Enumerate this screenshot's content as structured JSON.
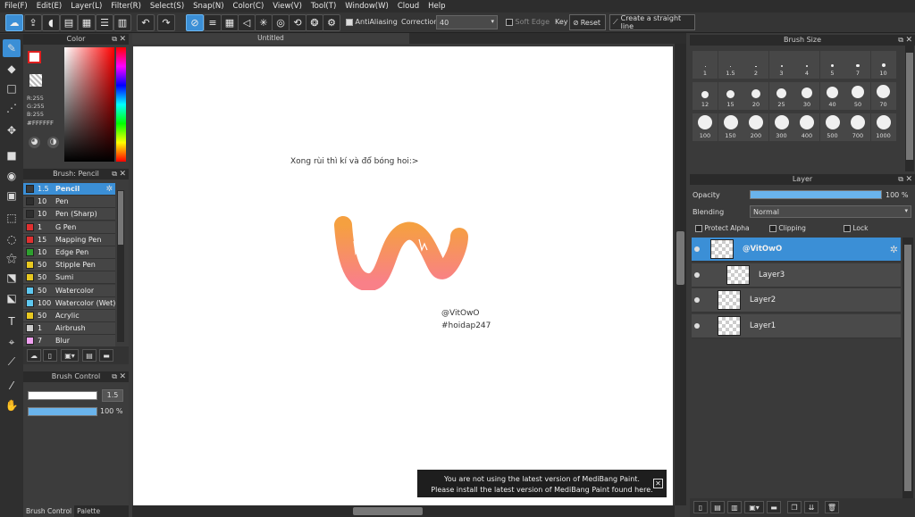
{
  "menu": [
    "File(F)",
    "Edit(E)",
    "Layer(L)",
    "Filter(R)",
    "Select(S)",
    "Snap(N)",
    "Color(C)",
    "View(V)",
    "Tool(T)",
    "Window(W)",
    "Cloud",
    "Help"
  ],
  "toolbar": {
    "antialiasing_label": "AntiAliasing",
    "correction_label": "Correction",
    "correction_value": "40",
    "soft_edge_label": "Soft Edge",
    "key_label": "Key",
    "reset_label": "Reset",
    "straight_line_label": "Create a straight line"
  },
  "color_panel": {
    "title": "Color",
    "r": "R:255",
    "g": "G:255",
    "b": "B:255",
    "hex": "#FFFFFF"
  },
  "brush_panel": {
    "title": "Brush: Pencil",
    "items": [
      {
        "size": "1.5",
        "name": "Pencil",
        "color": "#3b3b3b"
      },
      {
        "size": "10",
        "name": "Pen",
        "color": "#2e2e2e"
      },
      {
        "size": "10",
        "name": "Pen (Sharp)",
        "color": "#2e2e2e"
      },
      {
        "size": "1",
        "name": "G Pen",
        "color": "#e03030"
      },
      {
        "size": "15",
        "name": "Mapping Pen",
        "color": "#e03030"
      },
      {
        "size": "10",
        "name": "Edge Pen",
        "color": "#2ea02e"
      },
      {
        "size": "50",
        "name": "Stipple Pen",
        "color": "#e8c820"
      },
      {
        "size": "50",
        "name": "Sumi",
        "color": "#e8c820"
      },
      {
        "size": "50",
        "name": "Watercolor",
        "color": "#5ec8f0"
      },
      {
        "size": "100",
        "name": "Watercolor (Wet)",
        "color": "#5ec8f0"
      },
      {
        "size": "50",
        "name": "Acrylic",
        "color": "#e8c820"
      },
      {
        "size": "1",
        "name": "Airbrush",
        "color": "#cccccc"
      },
      {
        "size": "7",
        "name": "Blur",
        "color": "#f0a0f0"
      }
    ]
  },
  "brush_control": {
    "title": "Brush Control",
    "size_value": "1.5",
    "opacity_value": "100 %",
    "opacity_level": 1.0
  },
  "bottom_tabs": [
    "Brush Control",
    "Palette"
  ],
  "canvas": {
    "tab_title": "Untitled",
    "caption": "Xong rùi thì kí và đổ bóng hoi:>",
    "signature_line1": "@VitOwO",
    "signature_line2": "#hoidap247"
  },
  "notification": {
    "line1": "You are not using the latest version of MediBang Paint.",
    "line2": "Please install the latest version of MediBang Paint found here."
  },
  "brush_size_panel": {
    "title": "Brush Size",
    "sizes": [
      "1",
      "1.5",
      "2",
      "3",
      "4",
      "5",
      "7",
      "10",
      "12",
      "15",
      "20",
      "25",
      "30",
      "40",
      "50",
      "70",
      "100",
      "150",
      "200",
      "300",
      "400",
      "500",
      "700",
      "1000"
    ]
  },
  "layer_panel": {
    "title": "Layer",
    "opacity_label": "Opacity",
    "opacity_value": "100 %",
    "opacity_level": 1.0,
    "blending_label": "Blending",
    "blending_value": "Normal",
    "protect_alpha_label": "Protect Alpha",
    "clipping_label": "Clipping",
    "lock_label": "Lock",
    "layers": [
      {
        "name": "@VitOwO",
        "type": "folder",
        "selected": true
      },
      {
        "name": "Layer3",
        "type": "layer",
        "selected": false
      },
      {
        "name": "Layer2",
        "type": "layer",
        "selected": false
      },
      {
        "name": "Layer1",
        "type": "layer",
        "selected": false
      }
    ]
  },
  "colors": {
    "accent": "#3b8fd6",
    "panel_bg": "#3c3c3c",
    "canvas_bg": "#ffffff",
    "stroke_orange": "#f5a040",
    "stroke_pink": "#f98088"
  }
}
